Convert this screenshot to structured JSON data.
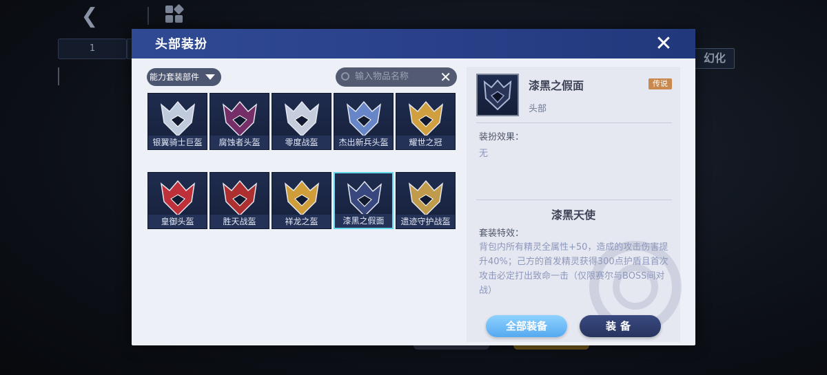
{
  "background": {
    "back_icon": "chevron-left-icon",
    "grid_icon": "grid-menu-icon",
    "tab_number": "1",
    "side_label": "幻化"
  },
  "dialog": {
    "title": "头部装扮",
    "close_icon": "close-icon",
    "filter": {
      "label": "能力套装部件",
      "icon": "caret-down-icon"
    },
    "search": {
      "placeholder": "输入物品名称",
      "icon": "search-icon",
      "clear_icon": "clear-icon"
    },
    "items": [
      {
        "name": "银翼骑士巨盔",
        "color": "#c8d4e6"
      },
      {
        "name": "腐蚀者头盔",
        "color": "#7a2f6a"
      },
      {
        "name": "零度战盔",
        "color": "#cfd6e6"
      },
      {
        "name": "杰出新兵头盔",
        "color": "#6c8ccf"
      },
      {
        "name": "耀世之冠",
        "color": "#d9a640"
      },
      {
        "name": "皇御头盔",
        "color": "#c8323a"
      },
      {
        "name": "胜天战盔",
        "color": "#b5302f"
      },
      {
        "name": "祥龙之盔",
        "color": "#d9a53a"
      },
      {
        "name": "漆黑之假面",
        "color": "#3a4a82"
      },
      {
        "name": "遗迹守护战盔",
        "color": "#c9a24c"
      }
    ],
    "selected_index": 8,
    "detail": {
      "name": "漆黑之假面",
      "rarity": "传说",
      "slot": "头部",
      "effect_title": "装扮效果：",
      "effect_value": "无",
      "set_name": "漆黑天使",
      "set_effect_title": "套装特效：",
      "set_effect_desc": "背包内所有精灵全属性+50，造成的攻击伤害提升40%；己方的首发精灵获得300点护盾且首次攻击必定打出致命一击（仅限赛尔与BOSS间对战）"
    },
    "buttons": {
      "equip_all": "全部装备",
      "equip": "装备"
    }
  },
  "colors": {
    "header_blue": "#2a418a",
    "selected_border": "#62d8e9",
    "rarity_tag": "#c9894e",
    "primary_button": "#55a9f0",
    "secondary_button": "#273460"
  }
}
